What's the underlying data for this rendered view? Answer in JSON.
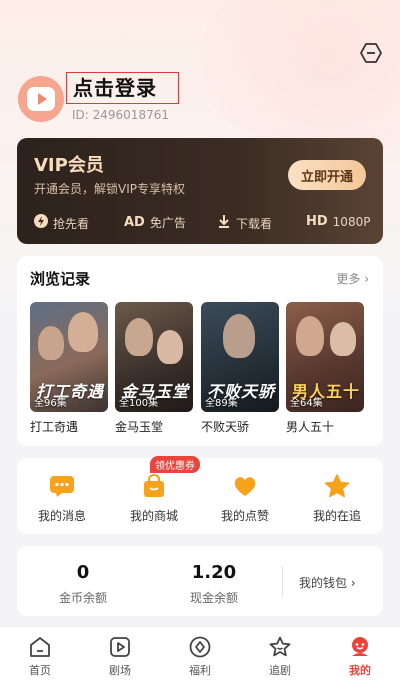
{
  "header": {
    "login_text": "点击登录",
    "user_id": "ID: 2496018761"
  },
  "vip": {
    "title": "VIP会员",
    "subtitle": "开通会员，解锁VIP专享特权",
    "button": "立即开通",
    "perks": [
      {
        "icon": "lightning-icon",
        "label": "抢先看"
      },
      {
        "icon_text": "AD",
        "label": "免广告"
      },
      {
        "icon": "download-icon",
        "label": "下载看"
      },
      {
        "icon_text": "HD",
        "label": "1080P"
      }
    ]
  },
  "history": {
    "title": "浏览记录",
    "more": "更多",
    "items": [
      {
        "name": "打工奇遇",
        "episodes": "全96集",
        "art": "打工奇遇"
      },
      {
        "name": "金马玉堂",
        "episodes": "全100集",
        "art": "金马玉堂"
      },
      {
        "name": "不败天骄",
        "episodes": "全89集",
        "art": "不败天骄"
      },
      {
        "name": "男人五十",
        "episodes": "全64集",
        "art": "男人五十"
      }
    ]
  },
  "actions": {
    "badge": "领优惠券",
    "items": [
      {
        "label": "我的消息",
        "icon": "message-icon"
      },
      {
        "label": "我的商城",
        "icon": "shop-bag-icon"
      },
      {
        "label": "我的点赞",
        "icon": "heart-icon"
      },
      {
        "label": "我的在追",
        "icon": "star-icon"
      }
    ]
  },
  "wallet": {
    "coins_value": "0",
    "coins_label": "金币余额",
    "cash_value": "1.20",
    "cash_label": "现金余额",
    "link": "我的钱包"
  },
  "tabbar": {
    "items": [
      {
        "label": "首页"
      },
      {
        "label": "剧场"
      },
      {
        "label": "福利"
      },
      {
        "label": "追剧"
      },
      {
        "label": "我的"
      }
    ]
  },
  "colors": {
    "accent": "#e8453c",
    "action_orange": "#f7a21b",
    "vip_gold": "#f7dcbd"
  }
}
